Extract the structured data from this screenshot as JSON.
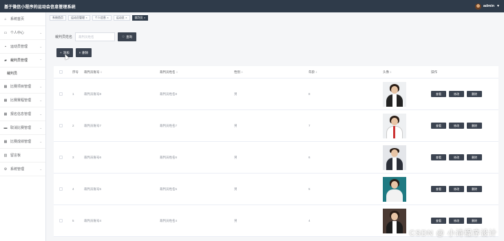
{
  "header": {
    "title": "基于微信小程序的运动会信息管理系统",
    "username": "admin"
  },
  "sidebar": {
    "items": [
      {
        "label": "系统首页",
        "icon": "home-icon"
      },
      {
        "label": "个人中心",
        "icon": "user-icon"
      },
      {
        "label": "运动员管理",
        "icon": "runner-icon"
      },
      {
        "label": "裁判员管理",
        "icon": "referee-icon",
        "active": true,
        "submenu": [
          "裁判员"
        ]
      },
      {
        "label": "比赛项目管理",
        "icon": "grid-icon"
      },
      {
        "label": "比赛赛程管理",
        "icon": "grid-icon"
      },
      {
        "label": "报名信息管理",
        "icon": "grid-icon"
      },
      {
        "label": "取消比赛管理",
        "icon": "monitor-icon"
      },
      {
        "label": "比赛成绩管理",
        "icon": "grid-icon"
      },
      {
        "label": "留言板",
        "icon": "chart-icon"
      },
      {
        "label": "系统管理",
        "icon": "gear-icon"
      }
    ]
  },
  "breadcrumbs": [
    "系统首页",
    "运动员管理",
    "个人信息",
    "运动员",
    "裁判员"
  ],
  "search": {
    "label": "裁判员姓名",
    "placeholder": "裁判员姓名",
    "button": "查询"
  },
  "actions": {
    "add": "添加",
    "delete": "删除"
  },
  "table": {
    "headers": {
      "index": "序号",
      "no": "裁判员账号",
      "name": "裁判员姓名",
      "sex": "性别",
      "age": "年龄",
      "photo": "头像",
      "ops": "操作"
    },
    "ops": {
      "view": "查看",
      "edit": "修改",
      "delete": "删除"
    },
    "rows": [
      {
        "index": "1",
        "no": "裁判员账号8",
        "name": "裁判员姓名8",
        "sex": "男",
        "age": "8"
      },
      {
        "index": "2",
        "no": "裁判员账号7",
        "name": "裁判员姓名7",
        "sex": "男",
        "age": "7"
      },
      {
        "index": "3",
        "no": "裁判员账号6",
        "name": "裁判员姓名6",
        "sex": "男",
        "age": "6"
      },
      {
        "index": "4",
        "no": "裁判员账号5",
        "name": "裁判员姓名5",
        "sex": "男",
        "age": "5"
      },
      {
        "index": "5",
        "no": "裁判员账号4",
        "name": "裁判员姓名4",
        "sex": "男",
        "age": "4"
      }
    ]
  },
  "watermark": "CSDN @ 小诗程序设计",
  "colors": {
    "topbar": "#2f3b4a",
    "button": "#3b4350",
    "background": "#f5f6f8"
  }
}
